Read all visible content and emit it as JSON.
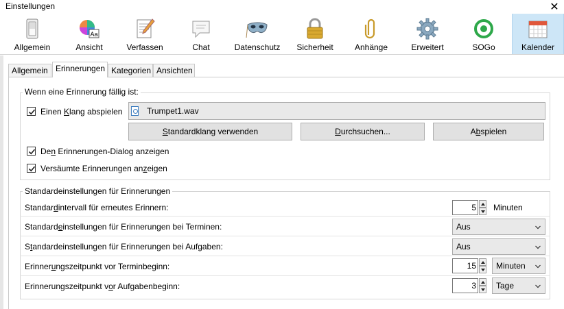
{
  "window": {
    "title": "Einstellungen",
    "close_glyph": "✕"
  },
  "toolbar": {
    "items": [
      {
        "label": "Allgemein",
        "icon": "light-switch-icon"
      },
      {
        "label": "Ansicht",
        "icon": "color-wheel-font-icon"
      },
      {
        "label": "Verfassen",
        "icon": "notepad-pencil-icon"
      },
      {
        "label": "Chat",
        "icon": "speech-bubble-icon"
      },
      {
        "label": "Datenschutz",
        "icon": "mask-icon"
      },
      {
        "label": "Sicherheit",
        "icon": "padlock-icon"
      },
      {
        "label": "Anhänge",
        "icon": "paperclip-icon"
      },
      {
        "label": "Erweitert",
        "icon": "gear-icon"
      },
      {
        "label": "SOGo",
        "icon": "sogo-icon"
      },
      {
        "label": "Kalender",
        "icon": "calendar-icon",
        "selected": true
      }
    ]
  },
  "tabs": [
    {
      "label": "Allgemein"
    },
    {
      "label": "Erinnerungen",
      "active": true
    },
    {
      "label": "Kategorien"
    },
    {
      "label": "Ansichten"
    }
  ],
  "due": {
    "legend": "Wenn eine Erinnerung fällig ist:",
    "play_sound": {
      "label_pre": "Einen ",
      "label_key": "K",
      "label_post": "lang abspielen",
      "checked": true
    },
    "sound_file": "Trumpet1.wav",
    "buttons": {
      "default_sound": {
        "pre": "",
        "key": "S",
        "post": "tandardklang verwenden"
      },
      "browse": {
        "pre": "",
        "key": "D",
        "post": "urchsuchen..."
      },
      "play": {
        "pre": "A",
        "key": "b",
        "post": "spielen"
      }
    },
    "show_dialog": {
      "label_pre": "De",
      "label_key": "n",
      "label_post": " Erinnerungen-Dialog anzeigen",
      "checked": true
    },
    "show_missed": {
      "label_pre": "Versäumte Erinnerungen an",
      "label_key": "z",
      "label_post": "eigen",
      "checked": true
    }
  },
  "defaults": {
    "legend": "Standardeinstellungen für Erinnerungen",
    "snooze": {
      "label_pre": "Standar",
      "label_key": "d",
      "label_post": "intervall für erneutes Erinnern:",
      "value": "5",
      "unit": "Minuten"
    },
    "events": {
      "label_pre": "Standard",
      "label_key": "e",
      "label_post": "instellungen für Erinnerungen bei Terminen:",
      "value": "Aus"
    },
    "tasks": {
      "label_pre": "S",
      "label_key": "t",
      "label_post": "andardeinstellungen für Erinnerungen bei Aufgaben:",
      "value": "Aus"
    },
    "event_offset": {
      "label_pre": "Erinner",
      "label_key": "u",
      "label_post": "ngszeitpunkt vor Terminbeginn:",
      "value": "15",
      "unit": "Minuten"
    },
    "task_offset": {
      "label_pre": "Erinnerungszeitpunkt v",
      "label_key": "o",
      "label_post": "r Aufgabenbeginn:",
      "value": "3",
      "unit": "Tage"
    }
  }
}
